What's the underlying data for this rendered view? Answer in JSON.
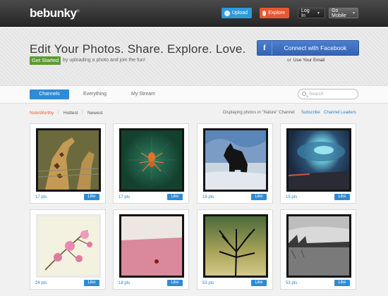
{
  "topbar": {
    "logo": "bebunky",
    "upload_label": "Upload",
    "explore_label": "Explore",
    "login_label": "Log In",
    "gomobile_label": "Go Mobile"
  },
  "hero": {
    "headline": "Edit Your Photos. Share. Explore. Love.",
    "get_started": "Get Started",
    "get_started_tail": "by uploading a photo and join the fun!",
    "facebook_label": "Connect with Facebook",
    "or_text": "or",
    "email_link": "Use Your Email"
  },
  "tabs": {
    "channels": "Channels",
    "everything": "Everything",
    "mystream": "My Stream",
    "search_placeholder": "Search"
  },
  "filters": {
    "noteworthy": "NoteWorthy",
    "hottest": "Hottest",
    "newest": "Newest",
    "status": "Displaying photos in \"Nature\" Channel",
    "subscribe": "Subscribe",
    "leaders": "Channel Leaders"
  },
  "photos": [
    {
      "pts": "17 pts",
      "like": "Like",
      "icon": "giraffe-photo"
    },
    {
      "pts": "17 pts",
      "like": "Like",
      "icon": "spider-photo"
    },
    {
      "pts": "16 pts",
      "like": "Like",
      "icon": "wolf-photo"
    },
    {
      "pts": "15 pts",
      "like": "Like",
      "icon": "sky-photo"
    },
    {
      "pts": "24 pts",
      "like": "Like",
      "icon": "flower-photo"
    },
    {
      "pts": "18 pts",
      "like": "Like",
      "icon": "beach-photo"
    },
    {
      "pts": "53 pts",
      "like": "Like",
      "icon": "tree-photo"
    },
    {
      "pts": "53 pts",
      "like": "Like",
      "icon": "lake-photo"
    }
  ],
  "colors": {
    "accent_blue": "#2f8bd6",
    "accent_orange": "#e8582f",
    "get_started_green": "#5b9b31",
    "facebook_blue": "#3463b4"
  }
}
